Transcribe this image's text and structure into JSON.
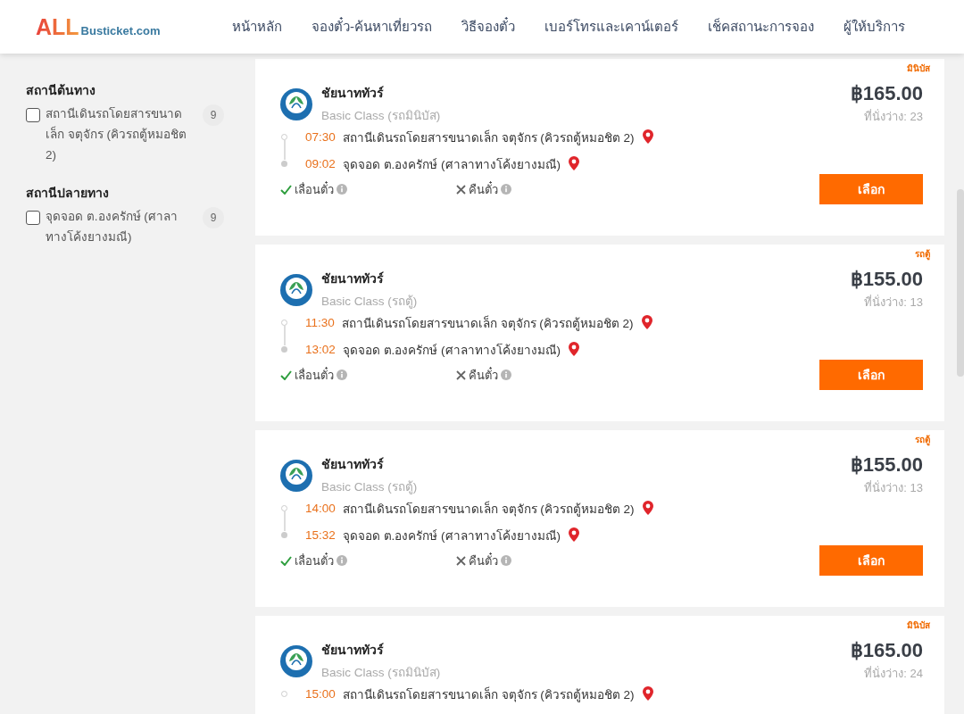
{
  "header": {
    "logo": {
      "part1": "ALL",
      "part2": "Busticket.com"
    },
    "nav": [
      {
        "label": "หน้าหลัก"
      },
      {
        "label": "จองตั๋ว-ค้นหาเที่ยวรถ"
      },
      {
        "label": "วิธีจองตั๋ว"
      },
      {
        "label": "เบอร์โทรและเคาน์เตอร์"
      },
      {
        "label": "เช็คสถานะการจอง"
      },
      {
        "label": "ผู้ให้บริการ"
      }
    ]
  },
  "sidebar": {
    "groups": [
      {
        "title": "สถานีต้นทาง",
        "options": [
          {
            "label": "สถานีเดินรถโดยสารขนาดเล็ก จตุจักร (คิวรถตู้หมอชิต 2)",
            "count": "9",
            "checked": false
          }
        ]
      },
      {
        "title": "สถานีปลายทาง",
        "options": [
          {
            "label": "จุดจอด ต.องครักษ์ (ศาลาทางโค้งยางมณี)",
            "count": "9",
            "checked": false
          }
        ]
      }
    ]
  },
  "trips": [
    {
      "tag": "มินิบัส",
      "operator": "ชัยนาททัวร์",
      "class": "Basic Class (รถมินิบัส)",
      "price": "฿165.00",
      "seats": "ที่นั่งว่าง: 23",
      "stops": [
        {
          "kind": "depart",
          "time": "07:30",
          "place": "สถานีเดินรถโดยสารขนาดเล็ก จตุจักร (คิวรถตู้หมอชิต 2)"
        },
        {
          "kind": "arrive",
          "time": "09:02",
          "place": "จุดจอด ต.องครักษ์ (ศาลาทางโค้งยางมณี)"
        }
      ],
      "features": [
        {
          "kind": "allowed",
          "label": "เลื่อนตั๋ว"
        },
        {
          "kind": "not_allowed",
          "label": "คืนตั๋ว"
        }
      ],
      "button": "เลือก"
    },
    {
      "tag": "รถตู้",
      "operator": "ชัยนาททัวร์",
      "class": "Basic Class (รถตู้)",
      "price": "฿155.00",
      "seats": "ที่นั่งว่าง: 13",
      "stops": [
        {
          "kind": "depart",
          "time": "11:30",
          "place": "สถานีเดินรถโดยสารขนาดเล็ก จตุจักร (คิวรถตู้หมอชิต 2)"
        },
        {
          "kind": "arrive",
          "time": "13:02",
          "place": "จุดจอด ต.องครักษ์ (ศาลาทางโค้งยางมณี)"
        }
      ],
      "features": [
        {
          "kind": "allowed",
          "label": "เลื่อนตั๋ว"
        },
        {
          "kind": "not_allowed",
          "label": "คืนตั๋ว"
        }
      ],
      "button": "เลือก"
    },
    {
      "tag": "รถตู้",
      "operator": "ชัยนาททัวร์",
      "class": "Basic Class (รถตู้)",
      "price": "฿155.00",
      "seats": "ที่นั่งว่าง: 13",
      "stops": [
        {
          "kind": "depart",
          "time": "14:00",
          "place": "สถานีเดินรถโดยสารขนาดเล็ก จตุจักร (คิวรถตู้หมอชิต 2)"
        },
        {
          "kind": "arrive",
          "time": "15:32",
          "place": "จุดจอด ต.องครักษ์ (ศาลาทางโค้งยางมณี)"
        }
      ],
      "features": [
        {
          "kind": "allowed",
          "label": "เลื่อนตั๋ว"
        },
        {
          "kind": "not_allowed",
          "label": "คืนตั๋ว"
        }
      ],
      "button": "เลือก"
    },
    {
      "tag": "มินิบัส",
      "operator": "ชัยนาททัวร์",
      "class": "Basic Class (รถมินิบัส)",
      "price": "฿165.00",
      "seats": "ที่นั่งว่าง: 24",
      "stops": [
        {
          "kind": "depart",
          "time": "15:00",
          "place": "สถานีเดินรถโดยสารขนาดเล็ก จตุจักร (คิวรถตู้หมอชิต 2)"
        }
      ]
    }
  ]
}
